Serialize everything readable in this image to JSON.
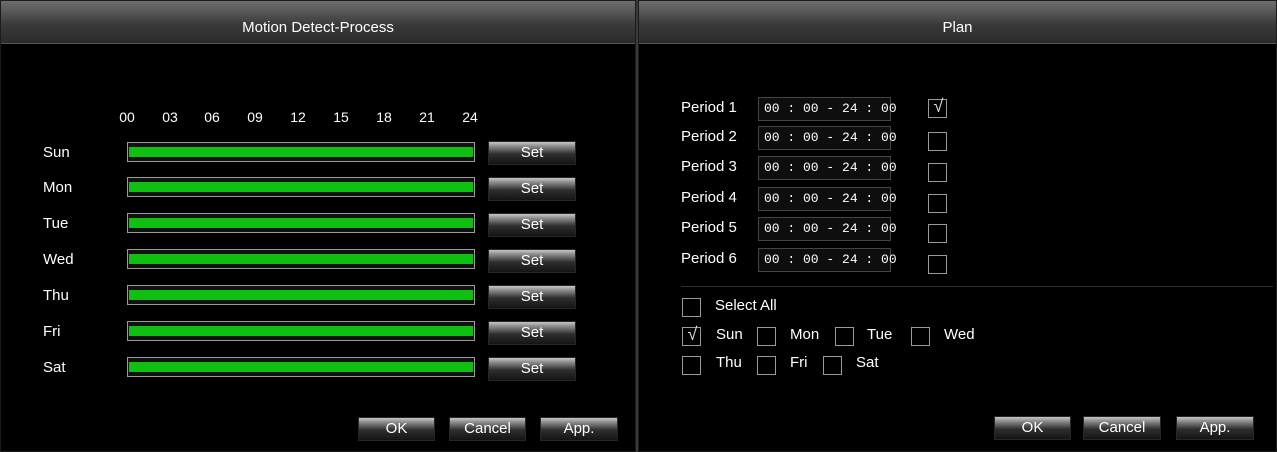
{
  "left": {
    "title": "Motion Detect-Process",
    "hours": [
      "00",
      "03",
      "06",
      "09",
      "12",
      "15",
      "18",
      "21",
      "24"
    ],
    "days": [
      {
        "label": "Sun",
        "set": "Set",
        "fill": 1.0
      },
      {
        "label": "Mon",
        "set": "Set",
        "fill": 1.0
      },
      {
        "label": "Tue",
        "set": "Set",
        "fill": 1.0
      },
      {
        "label": "Wed",
        "set": "Set",
        "fill": 1.0
      },
      {
        "label": "Thu",
        "set": "Set",
        "fill": 1.0
      },
      {
        "label": "Fri",
        "set": "Set",
        "fill": 1.0
      },
      {
        "label": "Sat",
        "set": "Set",
        "fill": 1.0
      }
    ],
    "bar_color": "#10c010",
    "buttons": {
      "ok": "OK",
      "cancel": "Cancel",
      "apply": "App."
    }
  },
  "right": {
    "title": "Plan",
    "periods": [
      {
        "label": "Period 1",
        "time": "00 : 00 - 24 : 00",
        "checked": true
      },
      {
        "label": "Period 2",
        "time": "00 : 00 - 24 : 00",
        "checked": false
      },
      {
        "label": "Period 3",
        "time": "00 : 00 - 24 : 00",
        "checked": false
      },
      {
        "label": "Period 4",
        "time": "00 : 00 - 24 : 00",
        "checked": false
      },
      {
        "label": "Period 5",
        "time": "00 : 00 - 24 : 00",
        "checked": false
      },
      {
        "label": "Period 6",
        "time": "00 : 00 - 24 : 00",
        "checked": false
      }
    ],
    "select_all": {
      "label": "Select All",
      "checked": false
    },
    "weekdays": [
      {
        "label": "Sun",
        "checked": true
      },
      {
        "label": "Mon",
        "checked": false
      },
      {
        "label": "Tue",
        "checked": false
      },
      {
        "label": "Wed",
        "checked": false
      },
      {
        "label": "Thu",
        "checked": false
      },
      {
        "label": "Fri",
        "checked": false
      },
      {
        "label": "Sat",
        "checked": false
      }
    ],
    "check_mark": "√",
    "buttons": {
      "ok": "OK",
      "cancel": "Cancel",
      "apply": "App."
    }
  }
}
